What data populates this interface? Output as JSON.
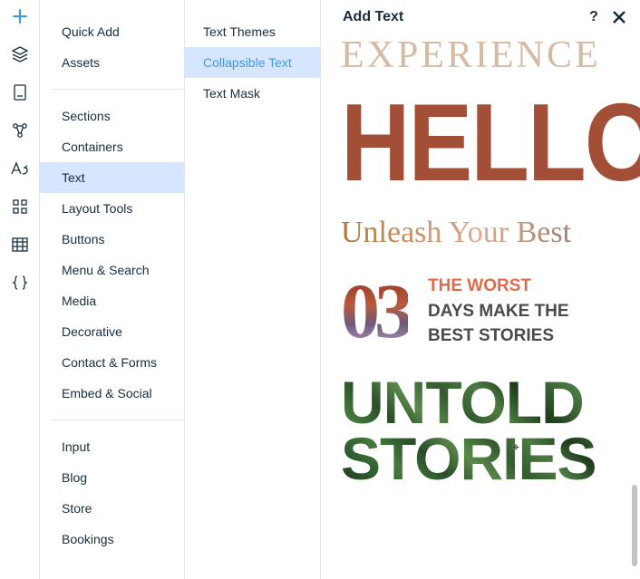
{
  "header": {
    "title": "Add Text"
  },
  "categories": {
    "group1": [
      {
        "key": "quick-add",
        "label": "Quick Add"
      },
      {
        "key": "assets",
        "label": "Assets"
      }
    ],
    "group2": [
      {
        "key": "sections",
        "label": "Sections"
      },
      {
        "key": "containers",
        "label": "Containers"
      },
      {
        "key": "text",
        "label": "Text",
        "selected": true
      },
      {
        "key": "layout-tools",
        "label": "Layout Tools"
      },
      {
        "key": "buttons",
        "label": "Buttons"
      },
      {
        "key": "menu-search",
        "label": "Menu & Search"
      },
      {
        "key": "media",
        "label": "Media"
      },
      {
        "key": "decorative",
        "label": "Decorative"
      },
      {
        "key": "contact-forms",
        "label": "Contact & Forms"
      },
      {
        "key": "embed-social",
        "label": "Embed & Social"
      }
    ],
    "group3": [
      {
        "key": "input",
        "label": "Input"
      },
      {
        "key": "blog",
        "label": "Blog"
      },
      {
        "key": "store",
        "label": "Store"
      },
      {
        "key": "bookings",
        "label": "Bookings"
      }
    ]
  },
  "subcategories": [
    {
      "key": "text-themes",
      "label": "Text Themes"
    },
    {
      "key": "collapsible-text",
      "label": "Collapsible Text",
      "selected": true
    },
    {
      "key": "text-mask",
      "label": "Text Mask"
    }
  ],
  "rail_icons": [
    {
      "name": "plus-icon"
    },
    {
      "name": "layers-icon"
    },
    {
      "name": "page-icon"
    },
    {
      "name": "nodes-icon"
    },
    {
      "name": "typography-icon"
    },
    {
      "name": "grid-apps-icon"
    },
    {
      "name": "table-icon"
    },
    {
      "name": "braces-icon"
    }
  ],
  "previews": {
    "experience": "EXPERIENCE",
    "hello": "HELLO",
    "unleash": "Unleash Your Best",
    "worst": {
      "num": "03",
      "line1": "THE WORST",
      "line2": "DAYS MAKE THE",
      "line3": "BEST STORIES"
    },
    "untold": {
      "line1": "UNTOLD",
      "line2": "STORIES"
    }
  }
}
